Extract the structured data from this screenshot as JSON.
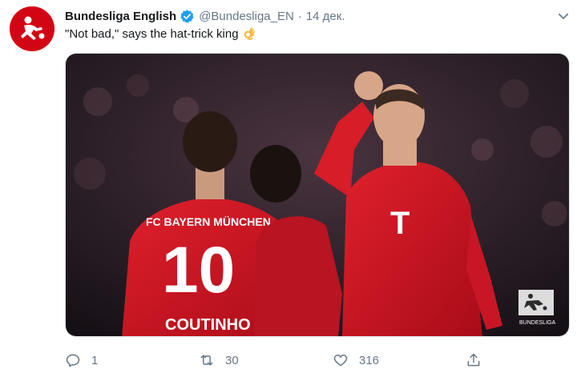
{
  "account": {
    "display_name": "Bundesliga English",
    "handle": "@Bundesliga_EN",
    "separator": "·",
    "timestamp": "14 дек.",
    "verified": true
  },
  "tweet": {
    "text": "\"Not bad,\" says the hat-trick king",
    "emoji": "ok-hand-emoji"
  },
  "media": {
    "jersey_club_text": "FC BAYERN MÜNCHEN",
    "jersey_number": "10",
    "jersey_name": "COUTINHO",
    "watermark_text": "BUNDESLIGA"
  },
  "actions": {
    "replies": "1",
    "retweets": "30",
    "likes": "316"
  },
  "colors": {
    "brand_red": "#d20515",
    "verified_blue": "#1da1f2",
    "secondary_text": "#657786"
  },
  "icons": {
    "menu": "chevron-down-icon",
    "reply": "reply-icon",
    "retweet": "retweet-icon",
    "like": "heart-icon",
    "share": "share-icon"
  }
}
